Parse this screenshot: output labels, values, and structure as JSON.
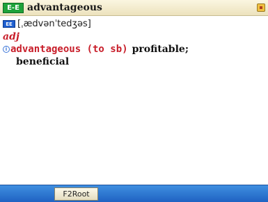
{
  "window": {
    "badge": "E-E",
    "headword": "advantageous"
  },
  "entry": {
    "phonetic_icon": "EE",
    "phonetic": "[ˌædvənˈtedʒəs]",
    "part_of_speech": "adj",
    "definition_icon": "i",
    "phrase": "advantageous (to sb)",
    "meaning_line1": "profitable;",
    "meaning_line2": "beneficial"
  },
  "toolbar": {
    "f2_label": "F2Root"
  },
  "colors": {
    "title_bg": "#f3ecd0",
    "badge_green": "#1fa23a",
    "accent_red": "#c81e2a",
    "bottom_bar_blue": "#2b74d4"
  },
  "icons": {
    "dictionary_badge": "dictionary-badge-icon",
    "corner": "window-corner-icon",
    "phonetic": "pronunciation-icon",
    "definition": "info-icon"
  }
}
